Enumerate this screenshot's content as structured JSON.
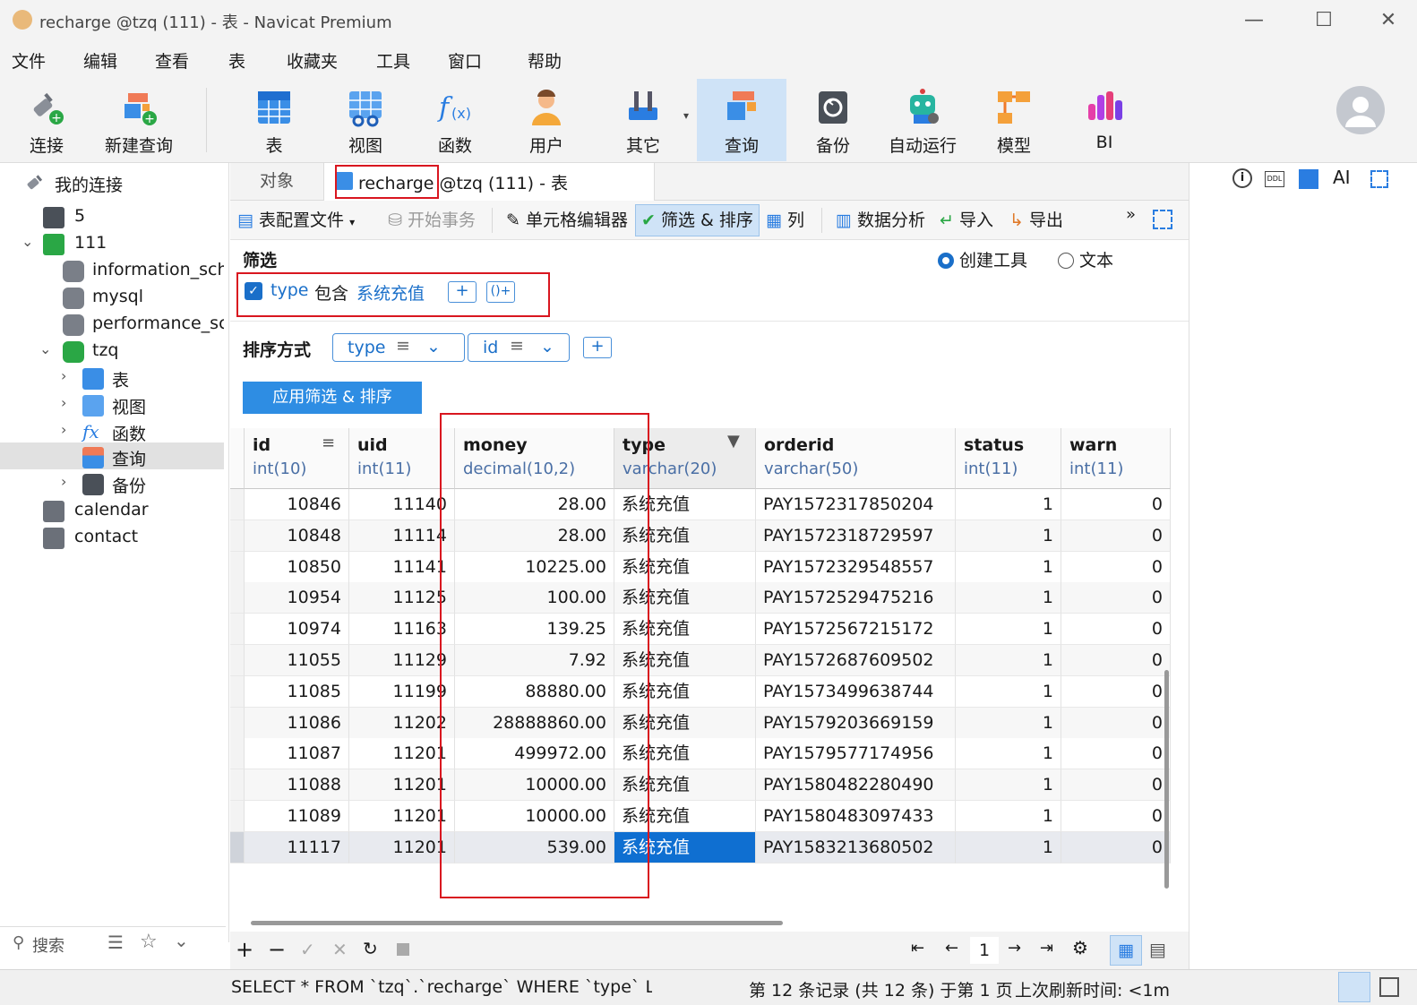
{
  "window": {
    "title": "recharge @tzq (111) - 表 - Navicat Premium",
    "minimize": "—",
    "maximize": "☐",
    "close": "✕"
  },
  "menu": [
    "文件",
    "编辑",
    "查看",
    "表",
    "收藏夹",
    "工具",
    "窗口",
    "帮助"
  ],
  "toolbar": [
    {
      "label": "连接",
      "icon": "plug-icon"
    },
    {
      "label": "新建查询",
      "icon": "new-query-icon"
    },
    {
      "label": "表",
      "icon": "table-icon"
    },
    {
      "label": "视图",
      "icon": "view-icon"
    },
    {
      "label": "函数",
      "icon": "function-icon"
    },
    {
      "label": "用户",
      "icon": "user-icon"
    },
    {
      "label": "其它",
      "icon": "tools-icon"
    },
    {
      "label": "查询",
      "icon": "query-icon"
    },
    {
      "label": "备份",
      "icon": "backup-icon"
    },
    {
      "label": "自动运行",
      "icon": "robot-icon"
    },
    {
      "label": "模型",
      "icon": "model-icon"
    },
    {
      "label": "BI",
      "icon": "bi-icon"
    }
  ],
  "sidebar": {
    "header": "我的连接",
    "items": [
      {
        "label": "5"
      },
      {
        "label": "111"
      },
      {
        "label": "information_sche"
      },
      {
        "label": "mysql"
      },
      {
        "label": "performance_sche"
      },
      {
        "label": "tzq"
      },
      {
        "label": "表"
      },
      {
        "label": "视图"
      },
      {
        "label": "函数"
      },
      {
        "label": "查询"
      },
      {
        "label": "备份"
      },
      {
        "label": "calendar"
      },
      {
        "label": "contact"
      }
    ],
    "search_placeholder": "搜索"
  },
  "tabs": {
    "objects": "对象",
    "active": "recharge @tzq (111) - 表"
  },
  "subtoolbar": {
    "table_config": "表配置文件",
    "begin_tx": "开始事务",
    "cell_editor": "单元格编辑器",
    "filter_sort": "筛选 & 排序",
    "columns": "列",
    "data_analysis": "数据分析",
    "import": "导入",
    "export": "导出",
    "more": "»"
  },
  "filter": {
    "title": "筛选",
    "mode_builder": "创建工具",
    "mode_text": "文本",
    "field": "type",
    "operator": "包含",
    "value": "系统充值",
    "add": "+",
    "add_group": "()+"
  },
  "sort": {
    "title": "排序方式",
    "fields": [
      "type",
      "id"
    ],
    "add": "+",
    "apply": "应用筛选 & 排序"
  },
  "columns": [
    {
      "name": "id",
      "type": "int(10)"
    },
    {
      "name": "uid",
      "type": "int(11)"
    },
    {
      "name": "money",
      "type": "decimal(10,2)"
    },
    {
      "name": "type",
      "type": "varchar(20)"
    },
    {
      "name": "orderid",
      "type": "varchar(50)"
    },
    {
      "name": "status",
      "type": "int(11)"
    },
    {
      "name": "warn",
      "type": "int(11)"
    }
  ],
  "rows": [
    [
      "10846",
      "11140",
      "28.00",
      "系统充值",
      "PAY1572317850204",
      "1",
      "0"
    ],
    [
      "10848",
      "11114",
      "28.00",
      "系统充值",
      "PAY1572318729597",
      "1",
      "0"
    ],
    [
      "10850",
      "11141",
      "10225.00",
      "系统充值",
      "PAY1572329548557",
      "1",
      "0"
    ],
    [
      "10954",
      "11125",
      "100.00",
      "系统充值",
      "PAY1572529475216",
      "1",
      "0"
    ],
    [
      "10974",
      "11163",
      "139.25",
      "系统充值",
      "PAY1572567215172",
      "1",
      "0"
    ],
    [
      "11055",
      "11129",
      "7.92",
      "系统充值",
      "PAY1572687609502",
      "1",
      "0"
    ],
    [
      "11085",
      "11199",
      "88880.00",
      "系统充值",
      "PAY1573499638744",
      "1",
      "0"
    ],
    [
      "11086",
      "11202",
      "28888860.00",
      "系统充值",
      "PAY1579203669159",
      "1",
      "0"
    ],
    [
      "11087",
      "11201",
      "499972.00",
      "系统充值",
      "PAY1579577174956",
      "1",
      "0"
    ],
    [
      "11088",
      "11201",
      "10000.00",
      "系统充值",
      "PAY1580482280490",
      "1",
      "0"
    ],
    [
      "11089",
      "11201",
      "10000.00",
      "系统充值",
      "PAY1580483097433",
      "1",
      "0"
    ],
    [
      "11117",
      "11201",
      "539.00",
      "系统充值",
      "PAY1583213680502",
      "1",
      "0"
    ]
  ],
  "pager": {
    "page": "1"
  },
  "status": {
    "sql": "SELECT * FROM `tzq`.`recharge` WHERE `type` LIKE '%",
    "records": "第 12 条记录 (共 12 条) 于第 1 页",
    "refresh": "上次刷新时间: <1m"
  },
  "colors": {
    "accent": "#2e8de3",
    "highlight": "#0f6fd1",
    "annotation": "#d9161f"
  }
}
